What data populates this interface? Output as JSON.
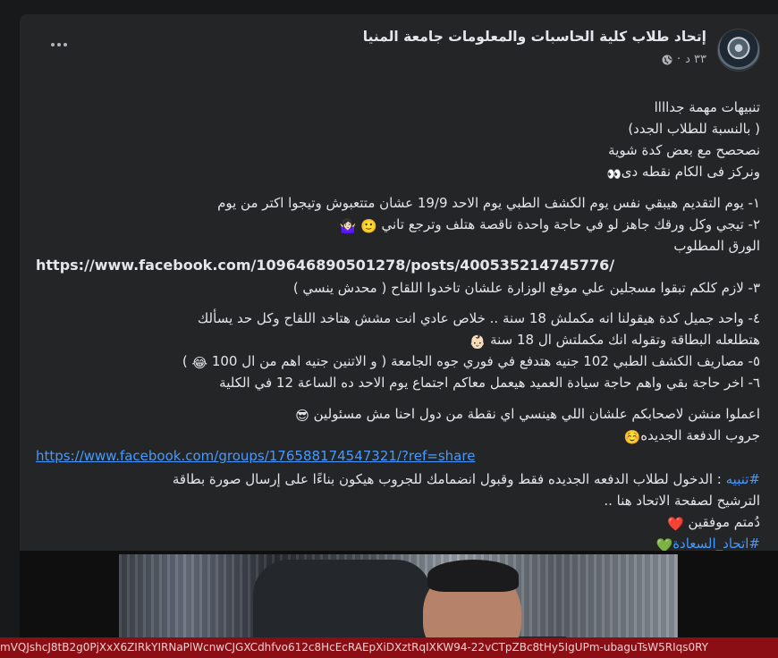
{
  "post": {
    "page_name": "إتحاد طلاب كلية الحاسبات والمعلومات جامعة المنيا",
    "time": "٣٣ د",
    "lines": [
      "تنبيهات مهمة جداااا",
      "( بالنسبة للطلاب الجدد)",
      "نصحصح مع بعض كدة شوية",
      "ونركز فى الكام نقطه دى",
      "١- يوم التقديم هيبقي نفس يوم الكشف الطبي يوم  الاحد 19/9 عشان متتعبوش وتيجوا اكتر من يوم",
      "٢- تيجي وكل ورقك جاهز لو في حاجة واحدة ناقصة هتلف وترجع تاني",
      "الورق المطلوب",
      "https://www.facebook.com/109646890501278/posts/400535214745776/",
      "٣- لازم كلكم تبقوا مسجلين علي موقع الوزارة علشان تاخدوا اللقاح ( محدش ينسي )",
      "٤- واحد جميل كدة هيقولنا انه مكملش 18 سنة .. خلاص عادي انت مشش هتاخد اللقاح وكل حد يسألك",
      "هتطلعله البطاقة وتقوله انك مكملتش ال 18 سنة",
      "٥- مصاريف الكشف الطبي 102 جنيه هتدفع في فوري جوه الجامعة ( و الاتنين جنيه اهم من ال 100",
      "٦- اخر حاجة بقي واهم حاجة سيادة العميد هيعمل معاكم اجتماع يوم الاحد ده الساعة 12 في الكلية",
      "اعملوا منشن لاصحابكم علشان اللي هينسي اي نقطة من دول احنا مش مسئولين",
      "جروب الدفعة الجديده",
      "https://www.facebook.com/groups/176588174547321/?ref=share",
      "#تنبيه",
      " :  الدخول لطلاب الدفعه الجديده فقط وقبول انضمامك للجروب هيكون بناءًا على إرسال صورة بطاقة",
      "الترشيح لصفحة الاتحاد هنا ..",
      "دُمتم موفقين",
      "#اتحاد_السعادة"
    ],
    "emojis": {
      "eyes": "👀",
      "woman_shrug": "🤷🏻‍♀️",
      "smile": "🙂",
      "baby": "👶🏻",
      "laugh": "😂",
      "sunglasses": "😎",
      "blush": "☺️",
      "heart": "❤️",
      "green_heart": "💚"
    }
  },
  "bottom_bar": {
    "text": "mVQJshcJ8tB2g0PjXxX6ZIRkYIRNaPlWcnwCJGXCdhfvo612c8HcEcRAEpXiDXztRqIXKW94-22vCTpZBc8tHy5IgUPm-ubaguTsW5RIqs0RY"
  },
  "colors": {
    "background": "#18191a",
    "card": "#242526",
    "text": "#e4e6eb",
    "secondary_text": "#b0b3b8",
    "link": "#4599ff",
    "bottom_bar": "#8b0e14"
  },
  "icons": {
    "more": "more-dots-icon",
    "privacy": "globe-icon",
    "avatar": "page-avatar"
  }
}
